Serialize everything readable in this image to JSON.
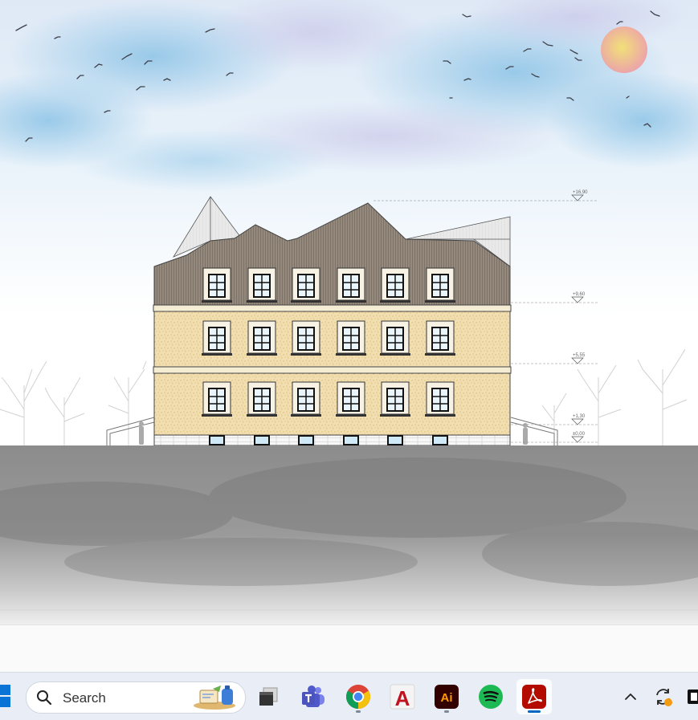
{
  "taskbar": {
    "search_label": "Search",
    "apps": [
      {
        "name": "task-view",
        "icon": "task-view-icon"
      },
      {
        "name": "teams",
        "icon": "teams-icon"
      },
      {
        "name": "chrome",
        "icon": "chrome-icon"
      },
      {
        "name": "autocad",
        "icon": "autocad-icon",
        "label": "A"
      },
      {
        "name": "illustrator",
        "icon": "illustrator-icon",
        "label": "Ai"
      },
      {
        "name": "spotify",
        "icon": "spotify-icon"
      },
      {
        "name": "acrobat",
        "icon": "acrobat-icon",
        "active": true
      }
    ]
  },
  "drawing": {
    "elevations": [
      "+16,90",
      "+9,60",
      "+5,55",
      "+1,30",
      "±0,00"
    ],
    "colors": {
      "roof": "#8f8478",
      "wall": "#efd9a6",
      "ground": "#8a8a8a",
      "sun": "#f2cc66",
      "sky": "#a9d2ea"
    }
  }
}
